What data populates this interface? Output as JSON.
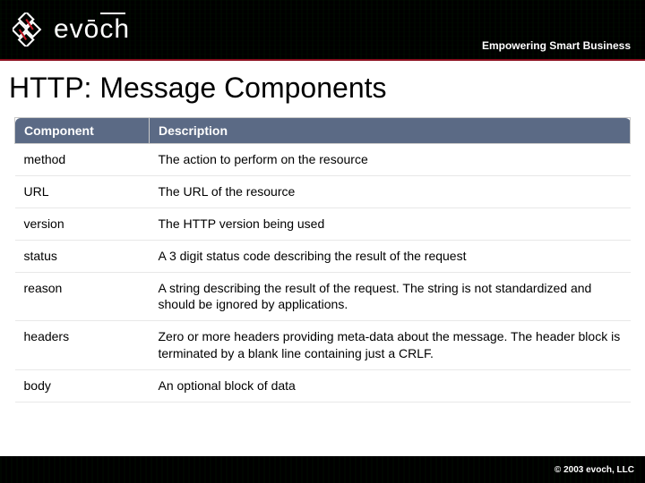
{
  "header": {
    "brand": "evōch",
    "tagline": "Empowering Smart Business"
  },
  "title": "HTTP: Message Components",
  "table": {
    "headers": {
      "component": "Component",
      "description": "Description"
    },
    "rows": [
      {
        "component": "method",
        "description": "The action to perform on the resource"
      },
      {
        "component": "URL",
        "description": "The URL of the resource"
      },
      {
        "component": "version",
        "description": "The HTTP version being used"
      },
      {
        "component": "status",
        "description": "A 3 digit status code describing the result of the request"
      },
      {
        "component": "reason",
        "description": "A string describing the result of the request.  The string is not standardized and should be ignored by applications."
      },
      {
        "component": "headers",
        "description": "Zero or more headers providing meta-data about the message. The header block is terminated by a blank line containing just a CRLF."
      },
      {
        "component": "body",
        "description": "An optional block of data"
      }
    ]
  },
  "footer": {
    "copyright": "© 2003  evoch, LLC"
  }
}
